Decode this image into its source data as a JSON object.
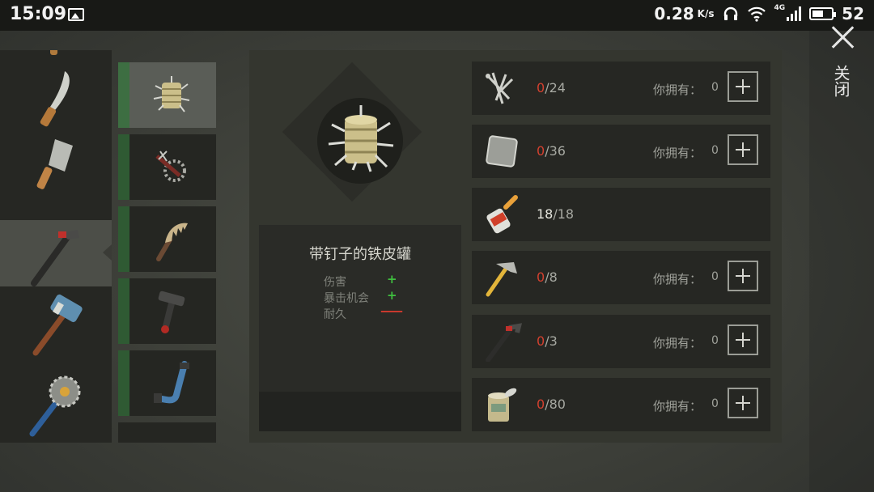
{
  "status_bar": {
    "time": "15:09",
    "net_speed": "0.28",
    "net_unit": "K/s",
    "network": "4G",
    "battery": "52",
    "icons": [
      "gallery-icon",
      "headphones-icon",
      "wifi-icon",
      "signal-icon",
      "battery-icon"
    ]
  },
  "categories": [
    {
      "name": "knife-icon"
    },
    {
      "name": "machete-icon"
    },
    {
      "name": "cleaver-icon"
    },
    {
      "name": "pipe-wrench-icon",
      "selected": true
    },
    {
      "name": "sledgehammer-icon"
    },
    {
      "name": "saw-mace-icon"
    }
  ],
  "items": [
    {
      "name": "nail-can-icon",
      "selected": true
    },
    {
      "name": "gear-bat-icon"
    },
    {
      "name": "spiked-bone-icon"
    },
    {
      "name": "pipe-tee-icon"
    },
    {
      "name": "blue-pipe-icon"
    },
    {
      "name": "partial-item-icon"
    }
  ],
  "detail": {
    "title": "带钉子的铁皮罐",
    "stats": [
      {
        "label": "伤害",
        "value": "+",
        "color": "#3fbf3f"
      },
      {
        "label": "暴击机会",
        "value": "+",
        "color": "#3fbf3f"
      },
      {
        "label": "耐久",
        "value": "——",
        "color": "#d03a2e"
      }
    ]
  },
  "requirements": [
    {
      "icon": "nails-icon",
      "have": "0",
      "need": "/24",
      "own_label": "你拥有：",
      "own": "0",
      "addable": true
    },
    {
      "icon": "metal-plate-icon",
      "have": "0",
      "need": "/36",
      "own_label": "你拥有：",
      "own": "0",
      "addable": true
    },
    {
      "icon": "glue-icon",
      "have": "18",
      "need": "/18",
      "own_label": "",
      "own": "",
      "addable": false
    },
    {
      "icon": "hammer-icon",
      "have": "0",
      "need": "/8",
      "own_label": "你拥有：",
      "own": "0",
      "addable": true
    },
    {
      "icon": "crowbar-icon",
      "have": "0",
      "need": "/3",
      "own_label": "你拥有：",
      "own": "0",
      "addable": true
    },
    {
      "icon": "tin-can-icon",
      "have": "0",
      "need": "/80",
      "own_label": "你拥有：",
      "own": "0",
      "addable": true
    }
  ],
  "close_label": "关闭",
  "colors": {
    "missing": "#d3402f",
    "bonus": "#3fbf3f",
    "accent_bar": "#2f5a33"
  }
}
